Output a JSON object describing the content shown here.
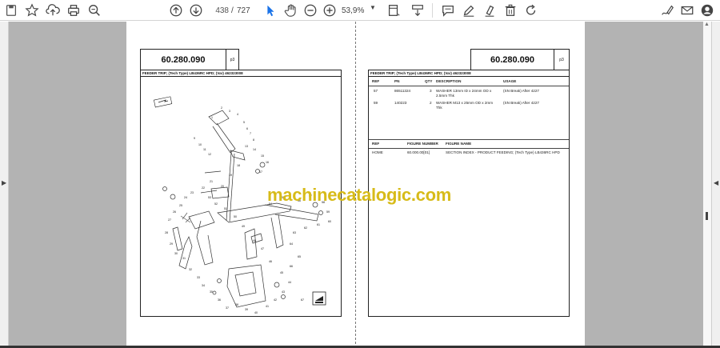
{
  "toolbar": {
    "current_page": "438",
    "page_separator": "/",
    "total_pages": "727",
    "zoom": "53,9%"
  },
  "document": {
    "left_page": {
      "section_number": "60.280.090",
      "page_label": "p3",
      "header": "FEEDER TRIP; (Tech Type) LB436RC HPD; (Var) 462323008",
      "callouts": [
        "1",
        "2",
        "3",
        "4",
        "5",
        "6",
        "7",
        "8",
        "9",
        "10",
        "11",
        "12",
        "13",
        "14",
        "15",
        "16",
        "17",
        "18",
        "19",
        "20",
        "21",
        "22",
        "23",
        "24",
        "25",
        "26",
        "27",
        "28",
        "29",
        "30",
        "31",
        "32",
        "33",
        "34",
        "35",
        "36",
        "37",
        "38",
        "39",
        "40",
        "41",
        "42",
        "43",
        "44",
        "45",
        "46",
        "47",
        "48",
        "49",
        "50",
        "51",
        "52",
        "53",
        "54",
        "55",
        "56",
        "57",
        "58",
        "59",
        "60",
        "61",
        "62",
        "63",
        "64",
        "65",
        "66",
        "67"
      ]
    },
    "right_page": {
      "section_number": "60.280.090",
      "page_label": "p3",
      "header": "FEEDER TRIP; (Tech Type) LB436RC HPD; (Var) 462323008",
      "parts_table": {
        "columns": [
          "REF",
          "PN",
          "QTY",
          "DESCRIPTION",
          "USAGE"
        ],
        "rows": [
          {
            "ref": "57",
            "pn": "86511324",
            "qty": "3",
            "description_1": "WASHER 13mm ID x 24mm OD x",
            "description_2": "2.5mm Thk",
            "usage": "(SN Break) After 4227"
          },
          {
            "ref": "59",
            "pn": "140223",
            "qty": "2",
            "description_1": "WASHER M13 x 25mm OD x 2mm",
            "description_2": "Thk",
            "usage": "(SN Break) After 4227"
          }
        ]
      },
      "figure_table": {
        "columns": [
          "REF",
          "FIGURE NUMBER",
          "FIGURE NAME"
        ],
        "rows": [
          {
            "ref": "HOME",
            "figure": "60.000.00[01]",
            "name": "SECTION INDEX - PRODUCT FEEDING; (Tech Type) LB436RC HPD"
          }
        ]
      }
    }
  },
  "watermark": "machinecatalogic.com",
  "colors": {
    "toolbar_bg": "#ffffff",
    "viewer_bg": "#b3b3b3",
    "watermark": "#d7bb19",
    "active_tool": "#1a73e8"
  },
  "icons": {
    "bookmark": "bookmark-icon",
    "star": "star-icon",
    "upload": "upload-icon",
    "print": "print-icon",
    "search": "search-icon",
    "prev_page": "arrow-up-circle-icon",
    "next_page": "arrow-down-circle-icon",
    "select": "cursor-arrow-icon",
    "hand": "hand-icon",
    "zoom_out": "zoom-out-icon",
    "zoom_in": "zoom-in-icon",
    "page_fit": "page-fit-icon",
    "keyboard": "scroll-mode-icon",
    "comment": "comment-icon",
    "draw": "pen-icon",
    "highlight": "highlight-icon",
    "delete": "trash-icon",
    "rotate": "rotate-icon",
    "edit_sign": "sign-icon",
    "mail": "mail-icon",
    "account": "account-icon"
  }
}
